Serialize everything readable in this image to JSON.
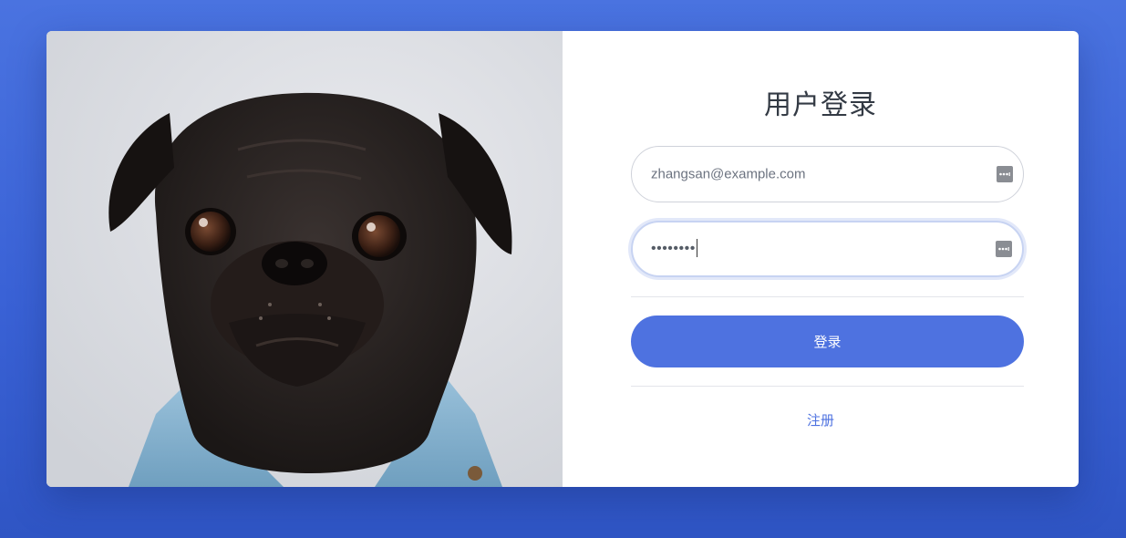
{
  "login": {
    "title": "用户登录",
    "email": {
      "value": "zhangsan@example.com",
      "icon": "password-manager-icon"
    },
    "password": {
      "masked_value": "••••••••",
      "icon": "password-manager-icon"
    },
    "submit_label": "登录",
    "register_label": "注册"
  },
  "hero_image": {
    "subject": "pug-in-denim-jacket-photo"
  },
  "colors": {
    "background": "#4a73e0",
    "accent": "#4e72e0",
    "card": "#ffffff"
  }
}
